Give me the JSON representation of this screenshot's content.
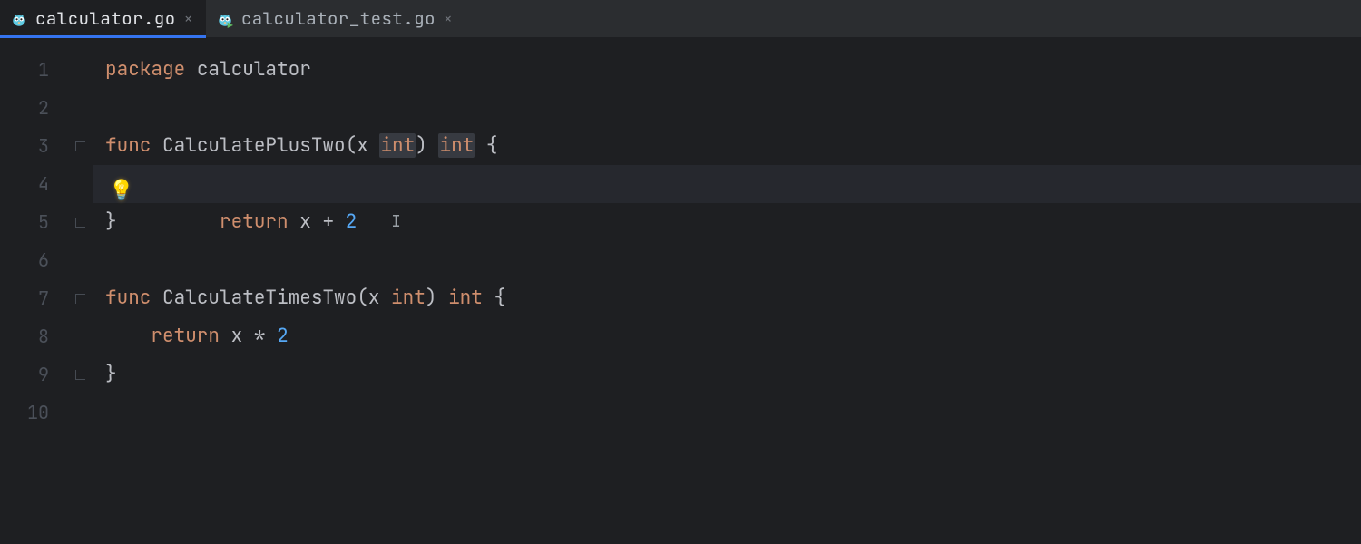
{
  "tabs": [
    {
      "label": "calculator.go",
      "active": true,
      "icon": "go-file-icon"
    },
    {
      "label": "calculator_test.go",
      "active": false,
      "icon": "go-test-file-icon"
    }
  ],
  "editor": {
    "active_file": "calculator.go",
    "line_numbers": [
      "1",
      "2",
      "3",
      "4",
      "5",
      "6",
      "7",
      "8",
      "9",
      "10"
    ],
    "current_line": 4,
    "intention_bulb_line": 4,
    "code": {
      "l1": {
        "kw": "package",
        "pkg": "calculator"
      },
      "l3": {
        "kw": "func",
        "name": "CalculatePlusTwo",
        "param": "x",
        "ptype": "int",
        "rtype": "int"
      },
      "l4": {
        "kw": "return",
        "expr_lhs": "x",
        "op": "+",
        "expr_rhs": "2"
      },
      "l7": {
        "kw": "func",
        "name": "CalculateTimesTwo",
        "param": "x",
        "ptype": "int",
        "rtype": "int"
      },
      "l8": {
        "kw": "return",
        "expr_lhs": "x",
        "op": "*",
        "expr_rhs": "2"
      },
      "brace_open": "{",
      "brace_close": "}"
    }
  },
  "icons": {
    "close": "×",
    "bulb": "💡"
  }
}
